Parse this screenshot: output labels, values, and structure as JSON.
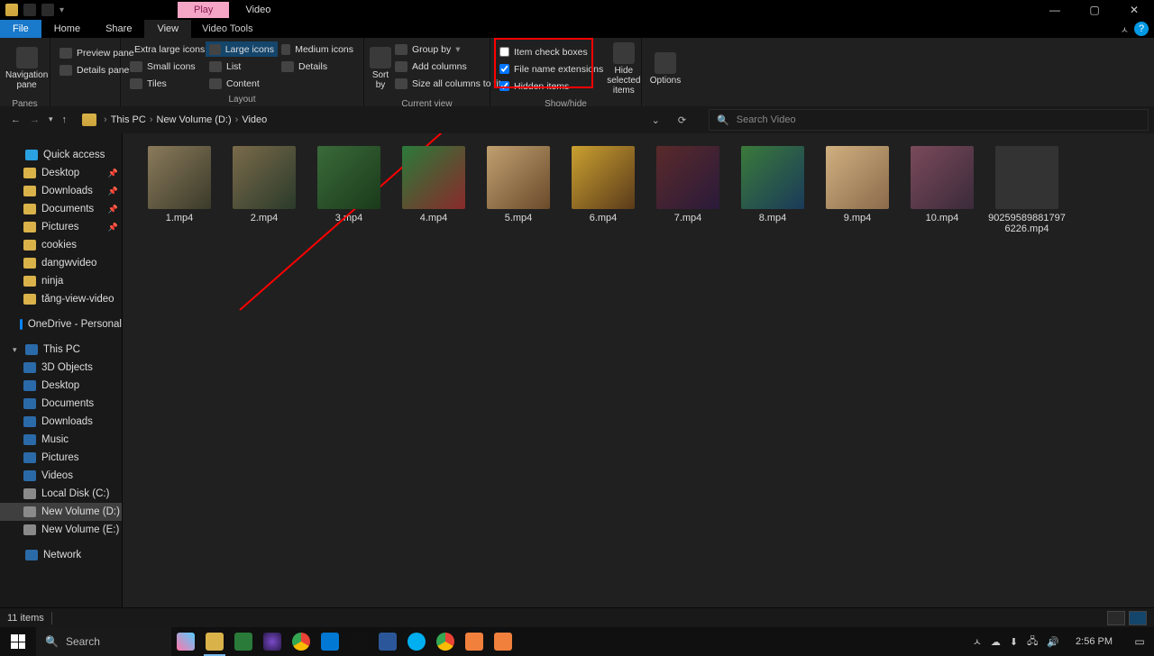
{
  "title": {
    "play_tab": "Play",
    "window_title": "Video"
  },
  "tabs": {
    "file": "File",
    "home": "Home",
    "share": "Share",
    "view": "View",
    "video_tools": "Video Tools"
  },
  "ribbon": {
    "panes": {
      "label": "Panes",
      "nav": "Navigation pane",
      "preview": "Preview pane",
      "details": "Details pane"
    },
    "layout": {
      "label": "Layout",
      "xl": "Extra large icons",
      "lg": "Large icons",
      "md": "Medium icons",
      "sm": "Small icons",
      "list": "List",
      "details": "Details",
      "tiles": "Tiles",
      "content": "Content"
    },
    "sort": {
      "label": "Current view",
      "sort": "Sort by",
      "group": "Group by",
      "addcols": "Add columns",
      "sizeall": "Size all columns to fit"
    },
    "showhide": {
      "label": "Show/hide",
      "checkboxes": "Item check boxes",
      "extensions": "File name extensions",
      "hidden": "Hidden items",
      "hidesel": "Hide selected items"
    },
    "options": "Options"
  },
  "breadcrumbs": [
    "This PC",
    "New Volume (D:)",
    "Video"
  ],
  "search_placeholder": "Search Video",
  "tree": {
    "quick": "Quick access",
    "quick_items": [
      "Desktop",
      "Downloads",
      "Documents",
      "Pictures",
      "cookies",
      "dangwvideo",
      "ninja",
      "tăng-view-video"
    ],
    "onedrive": "OneDrive - Personal",
    "thispc": "This PC",
    "pc_items": [
      "3D Objects",
      "Desktop",
      "Documents",
      "Downloads",
      "Music",
      "Pictures",
      "Videos",
      "Local Disk (C:)",
      "New Volume (D:)",
      "New Volume (E:)"
    ],
    "network": "Network"
  },
  "files": [
    "1.mp4",
    "2.mp4",
    "3.mp4",
    "4.mp4",
    "5.mp4",
    "6.mp4",
    "7.mp4",
    "8.mp4",
    "9.mp4",
    "10.mp4",
    "902595898817976226.mp4"
  ],
  "status": {
    "count": "11 items"
  },
  "taskbar": {
    "search": "Search",
    "time": "2:56 PM"
  }
}
